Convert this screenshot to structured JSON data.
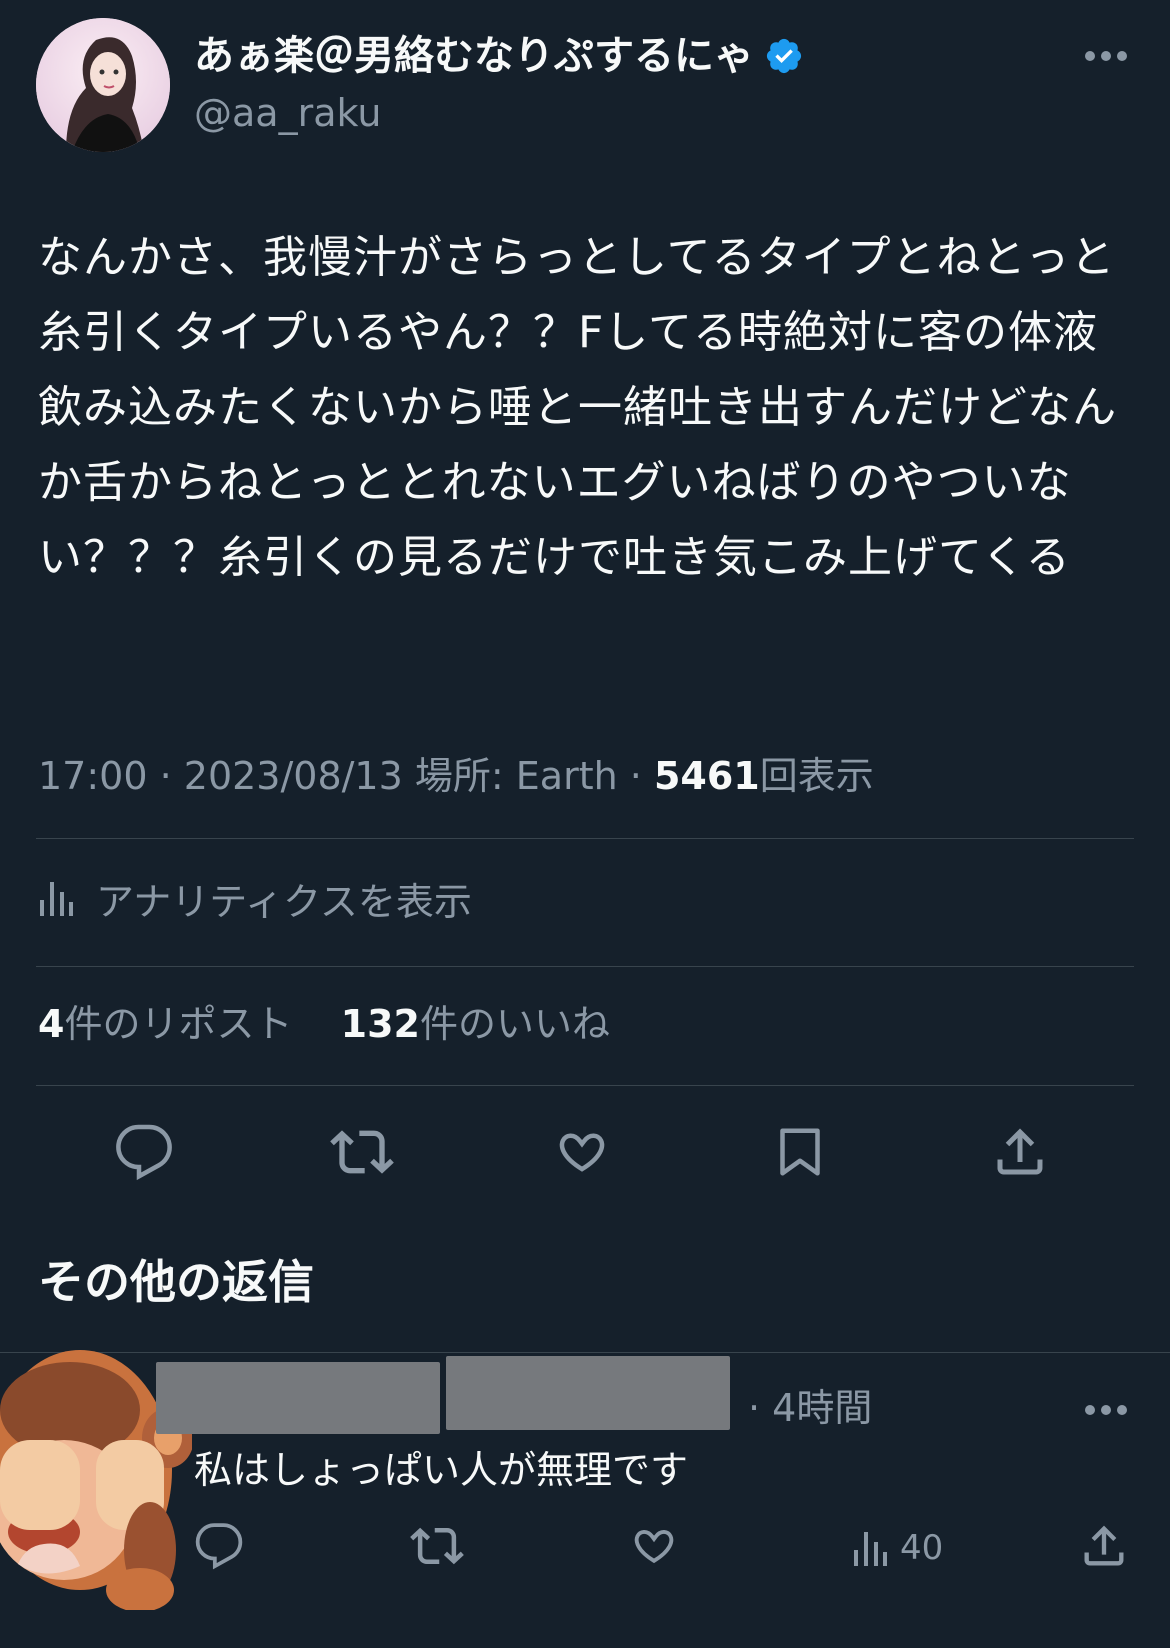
{
  "author": {
    "display_name": "あぁ楽＠男絡むなりぷするにゃ",
    "handle": "@aa_raku",
    "verified": true
  },
  "tweet": {
    "text": "なんかさ、我慢汁がさらっとしてるタイプとねとっと糸引くタイプいるやん？？Fしてる時絶対に客の体液飲み込みたくないから唾と一緒吐き出すんだけどなんか舌からねとっととれないエグいねばりのやついない？？？糸引くの見るだけで吐き気こみ上げてくる",
    "time": "17:00",
    "date": "2023/08/13",
    "location_label": "場所: Earth",
    "views_count": "5461",
    "views_suffix": "回表示"
  },
  "analytics": {
    "label": "アナリティクスを表示"
  },
  "stats": {
    "reposts_count": "4",
    "reposts_label": "件のリポスト",
    "likes_count": "132",
    "likes_label": "件のいいね"
  },
  "more_replies": {
    "heading": "その他の返信"
  },
  "reply": {
    "time": "· 4時間",
    "text": "私はしょっぱい人が無理です",
    "views_count": "40"
  },
  "colors": {
    "background": "#15202b",
    "text_primary": "#f7f9f9",
    "text_secondary": "#8b98a5",
    "divider": "#38444d",
    "verified_blue": "#1d9bf0"
  },
  "icons": {
    "header": [
      "more-icon",
      "verified-badge-icon"
    ],
    "actions": [
      "reply-icon",
      "repost-icon",
      "like-icon",
      "bookmark-icon",
      "share-icon"
    ],
    "analytics": "analytics-icon"
  }
}
